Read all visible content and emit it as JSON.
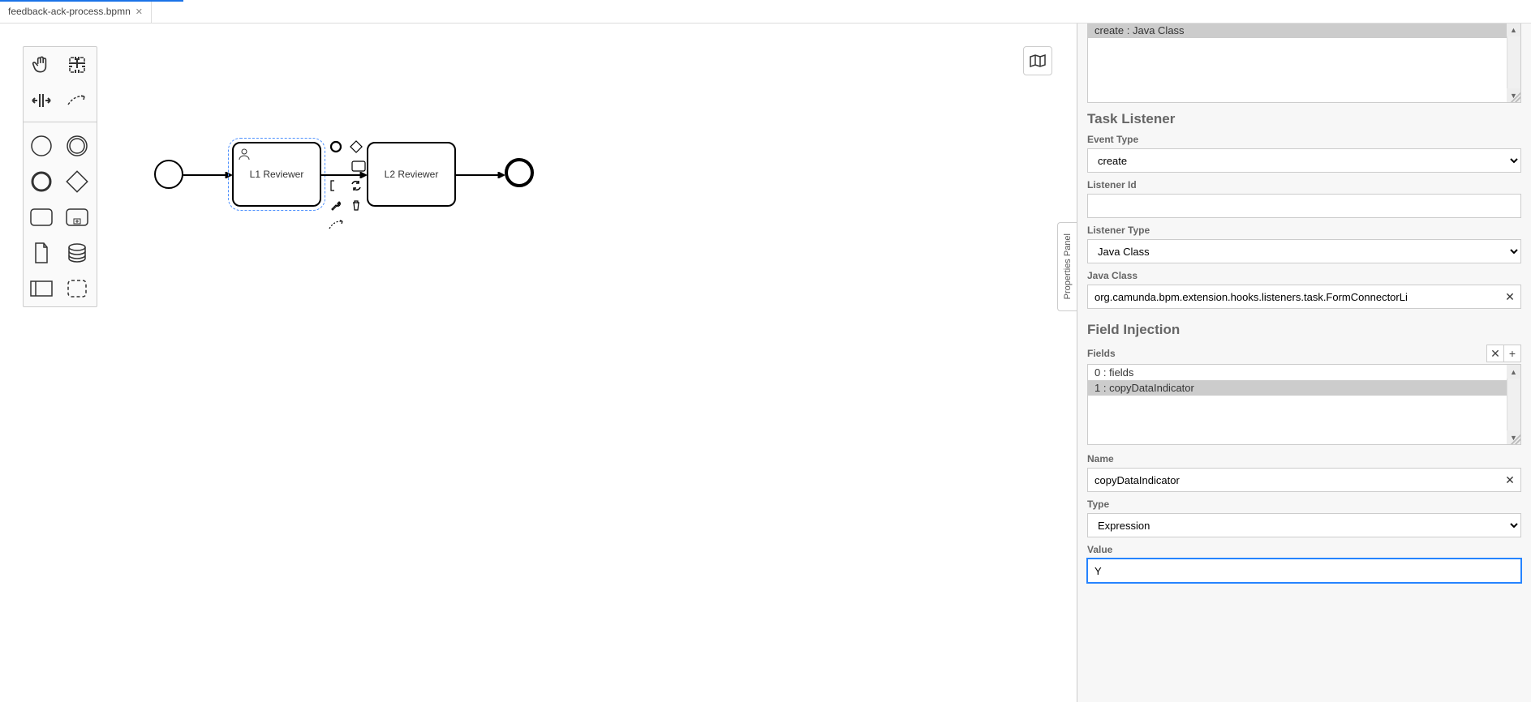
{
  "tab": {
    "title": "feedback-ack-process.bpmn"
  },
  "diagram": {
    "start_event": "",
    "task1_label": "L1 Reviewer",
    "task2_label": "L2 Reviewer",
    "end_event": ""
  },
  "panel_handle": "Properties Panel",
  "props": {
    "prev_listener_list": {
      "items": [
        "create : Java Class"
      ],
      "selected_index": 0
    },
    "task_listener_section": "Task Listener",
    "event_type_label": "Event Type",
    "event_type_options": [
      "create"
    ],
    "event_type_value": "create",
    "listener_id_label": "Listener Id",
    "listener_id_value": "",
    "listener_type_label": "Listener Type",
    "listener_type_options": [
      "Java Class"
    ],
    "listener_type_value": "Java Class",
    "java_class_label": "Java Class",
    "java_class_value": "org.camunda.bpm.extension.hooks.listeners.task.FormConnectorLi",
    "field_injection_section": "Field Injection",
    "fields_label": "Fields",
    "fields_items": [
      "0 : fields",
      "1 : copyDataIndicator"
    ],
    "fields_selected_index": 1,
    "name_label": "Name",
    "name_value": "copyDataIndicator",
    "type_label": "Type",
    "type_options": [
      "Expression"
    ],
    "type_value": "Expression",
    "value_label": "Value",
    "value_value": "Y"
  }
}
